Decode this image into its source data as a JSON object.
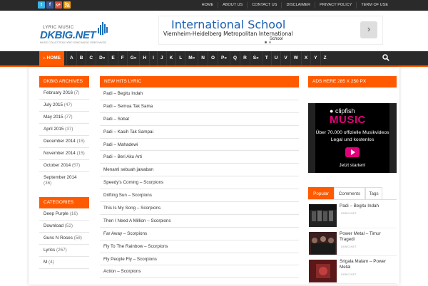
{
  "topbar": {
    "social": [
      "t",
      "f",
      "g+",
      "rss"
    ],
    "links": [
      "HOME",
      "ABOUT US",
      "CONTACT US",
      "DISCLAIMER",
      "PRIVACY POLICY",
      "TERM OF USE"
    ]
  },
  "logo": {
    "line1": "LYRIC MUSIC",
    "line2": "DKBIG.NET",
    "tagline": "MUSIC COLLECTION LYRIC SONG MUSIC VIDEO MUSIC"
  },
  "ad": {
    "title": "International School",
    "subtitle": "Viernheim-Heidelberg Metropolitan International",
    "subtitle2": "School",
    "go_icon": "chevron-right-icon"
  },
  "nav": {
    "home": "HOME",
    "letters": [
      "A",
      "B",
      "C",
      "D»",
      "E",
      "F",
      "G»",
      "H",
      "I",
      "J",
      "K",
      "L",
      "M»",
      "N",
      "O",
      "P»",
      "Q",
      "R",
      "S»",
      "T",
      "U",
      "V",
      "W",
      "X",
      "Y",
      "Z"
    ],
    "search_icon": "search-icon"
  },
  "archives": {
    "title": "DKBIG ARCHIVES",
    "items": [
      {
        "label": "February 2016",
        "count": "(7)"
      },
      {
        "label": "July 2015",
        "count": "(47)"
      },
      {
        "label": "May 2015",
        "count": "(77)"
      },
      {
        "label": "April 2015",
        "count": "(37)"
      },
      {
        "label": "December 2014",
        "count": "(15)"
      },
      {
        "label": "November 2014",
        "count": "(15)"
      },
      {
        "label": "October 2014",
        "count": "(57)"
      },
      {
        "label": "September 2014",
        "count": "(36)"
      }
    ]
  },
  "categories": {
    "title": "CATEGORIES",
    "items": [
      {
        "label": "Deep Purple",
        "count": "(16)"
      },
      {
        "label": "Download",
        "count": "(52)"
      },
      {
        "label": "Guns N Roses",
        "count": "(58)"
      },
      {
        "label": "Lyrics",
        "count": "(267)"
      },
      {
        "label": "M",
        "count": "(4)"
      }
    ]
  },
  "newhits": {
    "title": "NEW HITS LYRIC",
    "items": [
      "Padi – Begitu Indah",
      "Padi – Semua Tak Sama",
      "Padi – Sobat",
      "Padi – Kasih Tak Sampai",
      "Padi – Mahadewi",
      "Padi – Beri Aku Arti",
      "Menanti sebuah jawaban",
      "Speedy's Coming – Scorpions",
      "Drifting Sun – Scorpions",
      "This Is My Song – Scorpions",
      "Then I Need A Million – Scorpions",
      "Far Away – Scorpions",
      "Fly To The Rainbow – Scorpions",
      "Fly People Fly – Scorpions",
      "Action – Scorpions"
    ]
  },
  "right": {
    "ads_title": "ADS HERE 285 X 250 PX",
    "clipfish": {
      "brand": "clipfish",
      "music": "MUSIC",
      "line1": "Über 70.000 offizielle Musikvideos",
      "line2": "Legal und kostenlos",
      "cta": "Jetzt starten!"
    },
    "tabs": [
      "Popular",
      "Comments",
      "Tags"
    ],
    "popular": [
      {
        "title": "Padi – Begitu Indah",
        "meta": "DKBIG.NET"
      },
      {
        "title": "Power Metal – Timur Tragedi",
        "meta": "DKBIG.NET"
      },
      {
        "title": "Srigala Malam – Power Metal",
        "meta": "DKBIG.NET"
      }
    ]
  },
  "colors": {
    "accent": "#ff5a00",
    "dark": "#2a2a2a",
    "brand_blue": "#1f6fb5",
    "clipfish_pink": "#e2007a"
  }
}
